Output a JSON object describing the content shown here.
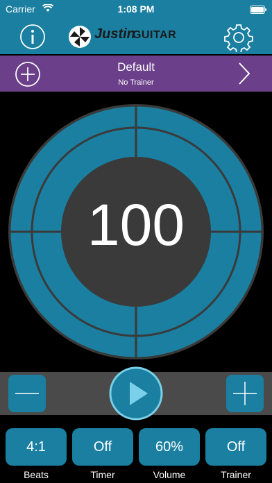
{
  "status_bar": {
    "carrier": "Carrier",
    "time": "1:08 PM"
  },
  "header": {
    "logo_script": "Justin",
    "logo_brand": "GUITAR",
    "info_icon": "info-icon",
    "settings_icon": "gear-icon"
  },
  "preset": {
    "name": "Default",
    "trainer": "No Trainer"
  },
  "tempo": {
    "bpm": "100"
  },
  "bottom": {
    "beats": {
      "value": "4:1",
      "label": "Beats"
    },
    "timer": {
      "value": "Off",
      "label": "Timer"
    },
    "volume": {
      "value": "60%",
      "label": "Volume"
    },
    "trainer": {
      "value": "Off",
      "label": "Trainer"
    }
  },
  "colors": {
    "accent": "#1a7fa0",
    "preset_bar": "#6b3f8a",
    "center": "#3a3a3a",
    "play": "#1a7fa0"
  }
}
